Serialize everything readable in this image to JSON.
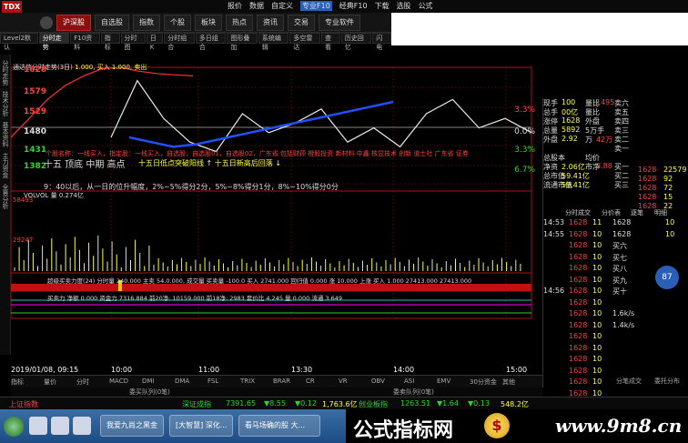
{
  "app": {
    "logo_text": "TDX",
    "menu": [
      "报价",
      "数据",
      "自定义",
      "专业F10",
      "经典F10",
      "下载",
      "选股",
      "公式",
      "选股"
    ]
  },
  "toolbar": {
    "buttons": [
      "沪深股",
      "自选股",
      "指数",
      "个股",
      "板块",
      "热点",
      "资讯",
      "交易",
      "专业软件"
    ]
  },
  "subtabs": [
    "Level2默认",
    "分时走势",
    "F10资料",
    "指标",
    "分时图",
    "日K",
    "分时组合",
    "多日组合",
    "图形叠加",
    "系统编辑",
    "多空雷达",
    "查看",
    "历史回忆",
    "闪电"
  ],
  "left_rail": [
    "分时走势",
    "技术分析",
    "基本资料",
    "主力资金",
    "全景分析",
    "财务数据",
    "行业新闻"
  ],
  "chart": {
    "title_prefix": "通达信分时走势(3日)",
    "title_values": "1.000, 买入 1.000, 卖出",
    "price_left": [
      "1628",
      "1579",
      "1529",
      "1480",
      "1431",
      "1382"
    ],
    "pct_right": [
      "3.3%",
      "0.0%",
      "3.3%",
      "6.7%"
    ],
    "headline": "十五 顶底 中期 高点",
    "overlay_red": "个股名称：一线买入，指定股：一线买入，自选股，自选股01，自选股02，广东省 包括财顾 橙股投资 新材料 中鑫 核显技术 创新 道士社 广东省 证券",
    "overlay_mid": "十五日低点突破阳线 ↑ 十五日新高后回落 ↓",
    "rule_text": "9：40以后，从一日的位升幅度，2%~5%得分2分，5%~8%得分1分，8%~10%得分0分",
    "vol_label_1": "VOLVOL 量 0.274亿",
    "vol_label_2": "超级买卖力度(24) 分时量 240.000 主卖 54.0.000, 成交量 买卖量 -100.0 买入 2741.000 回归值 0.000 涨 10.000 上涨 买入 1.000 27413.000 27413.000",
    "vol_label_3": "买卖力 净额 0.000 资金力 7316.884 前20净: 10159.000 前18净: 2983 套价比 4.245 量 0.000 流通 3.649",
    "left_vol_ticks": [
      "58493",
      "29247",
      "1.17"
    ],
    "time_labels": [
      "2019/01/08, 09:15",
      "10:00",
      "11:00",
      "13:30",
      "14:00",
      "15:00"
    ],
    "bottom_tabs": [
      "指标",
      "量价",
      "分时",
      "MACD",
      "DMI",
      "DMA",
      "FSL",
      "TRIX",
      "BRAR",
      "CR",
      "VR",
      "OBV",
      "ASI",
      "EMV",
      "30分资金",
      "其他"
    ],
    "range_left": "委买队列(0笔)",
    "range_right": "委卖队列(0笔)"
  },
  "chart_data": {
    "type": "line",
    "x_range": [
      "09:30",
      "15:00"
    ],
    "y_range": [
      1382,
      1628
    ],
    "pct_range": [
      -6.7,
      3.3
    ],
    "series": [
      {
        "name": "",
        "color": "#ff3030",
        "values": [
          1480,
          1520,
          1560,
          1590,
          1610,
          1625,
          1628,
          1620,
          1615,
          1612,
          1610
        ]
      },
      {
        "name": "",
        "color": "#e8e8e8",
        "values": [
          1480,
          1600,
          1520,
          1470,
          1450,
          1530,
          1490,
          1510,
          1540,
          1470,
          1500,
          1460,
          1530,
          1560,
          1500,
          1520,
          1490
        ]
      },
      {
        "name": "",
        "color": "#2050ff",
        "values": [
          1480,
          1470,
          1460,
          1465,
          1475,
          1485,
          1495,
          1505,
          1515,
          1525,
          1535,
          1545,
          1555
        ]
      }
    ]
  },
  "quote": {
    "rows": [
      {
        "l": "现手",
        "v": "100",
        "l2": "量比",
        "v2": "1495",
        "r": "卖六"
      },
      {
        "l": "总手",
        "v": "00亿",
        "l2": "量比",
        "v2": "",
        "r": "卖五"
      },
      {
        "l": "涨停",
        "v": "1628",
        "l2": "外盘",
        "v2": "",
        "r": "卖四"
      },
      {
        "l": "总量",
        "v": "5892",
        "l2": "5万手",
        "v2": "",
        "r": "卖三"
      },
      {
        "l": "外盘",
        "v": "2.92",
        "l2": "万",
        "v2": "42万",
        "r": "卖二"
      },
      {
        "l": "",
        "v": "",
        "l2": "",
        "v2": "",
        "r": "卖一"
      },
      {
        "l": "总股本",
        "v": "",
        "l2": "均价",
        "v2": "",
        "r": ""
      },
      {
        "l": "净资",
        "v": "2.06亿",
        "l2": "市净",
        "v2": "3.88",
        "r": "买一"
      },
      {
        "l": "总市值",
        "v": "59.41亿",
        "l2": "",
        "v2": "",
        "r": "买二"
      },
      {
        "l": "流通市值",
        "v": "59.41亿",
        "l2": "",
        "v2": "",
        "r": "买三"
      }
    ],
    "book": [
      {
        "p": "1628",
        "q": "22579"
      },
      {
        "p": "1628",
        "q": "92"
      },
      {
        "p": "1628",
        "q": "72"
      },
      {
        "p": "1628",
        "q": "15"
      },
      {
        "p": "1628",
        "q": "22"
      }
    ],
    "tabs": [
      "分时成交",
      "分价表",
      "逐笔",
      "明细"
    ],
    "ticks": [
      {
        "t": "14:53",
        "p": "1628",
        "q": "11"
      },
      {
        "t": "14:55",
        "p": "1628",
        "q": "10"
      },
      {
        "t": "",
        "p": "1628",
        "q": "10"
      },
      {
        "t": "",
        "p": "1628",
        "q": "10"
      },
      {
        "t": "",
        "p": "1628",
        "q": "10"
      },
      {
        "t": "",
        "p": "1628",
        "q": "10"
      },
      {
        "t": "14:56",
        "p": "1628",
        "q": "10"
      },
      {
        "t": "",
        "p": "1628",
        "q": "10"
      },
      {
        "t": "",
        "p": "1628",
        "q": "10"
      },
      {
        "t": "",
        "p": "1628",
        "q": "10"
      },
      {
        "t": "",
        "p": "1628",
        "q": "10"
      },
      {
        "t": "",
        "p": "1628",
        "q": "10"
      },
      {
        "t": "",
        "p": "1628",
        "q": "10"
      },
      {
        "t": "",
        "p": "1628",
        "q": "10"
      },
      {
        "t": "",
        "p": "1628",
        "q": "10"
      },
      {
        "t": "",
        "p": "1628",
        "q": "10"
      },
      {
        "t": "",
        "p": "1628",
        "q": "10"
      }
    ],
    "ladder": [
      {
        "p": "1628",
        "q": "10"
      },
      {
        "p": "1628",
        "q": "10"
      },
      {
        "p": "买六",
        "q": ""
      },
      {
        "p": "买七",
        "q": ""
      },
      {
        "p": "买八",
        "q": ""
      },
      {
        "p": "买九",
        "q": ""
      },
      {
        "p": "买十",
        "q": ""
      },
      {
        "p": "",
        "q": ""
      },
      {
        "p": "1.6k/s",
        "q": ""
      },
      {
        "p": "1.4k/s",
        "q": ""
      }
    ],
    "zoom": "87",
    "footer_tabs": [
      "分笔成交",
      "委托分布"
    ]
  },
  "index_bar": {
    "items": [
      {
        "name": "上证指数",
        "val": "",
        "chg": "",
        "pct": ""
      },
      {
        "name": "深证成指",
        "val": "7391.65",
        "chg": "▼8.55",
        "pct": "▼0.12"
      },
      {
        "name": "",
        "val": "1,763.6亿",
        "chg": "",
        "pct": ""
      },
      {
        "name": "创业板指",
        "val": "1263.51",
        "chg": "▼1.64",
        "pct": "▼0.13"
      },
      {
        "name": "",
        "val": "548.2亿",
        "chg": "",
        "pct": ""
      }
    ]
  },
  "taskbar": {
    "buttons": [
      "我爱九尚之黑金",
      "[大智慧] 深化...",
      "看马场确的股 大..."
    ]
  },
  "banner": {
    "text": "公式指标网",
    "coin": "$",
    "url": "www.9m8.cn"
  }
}
